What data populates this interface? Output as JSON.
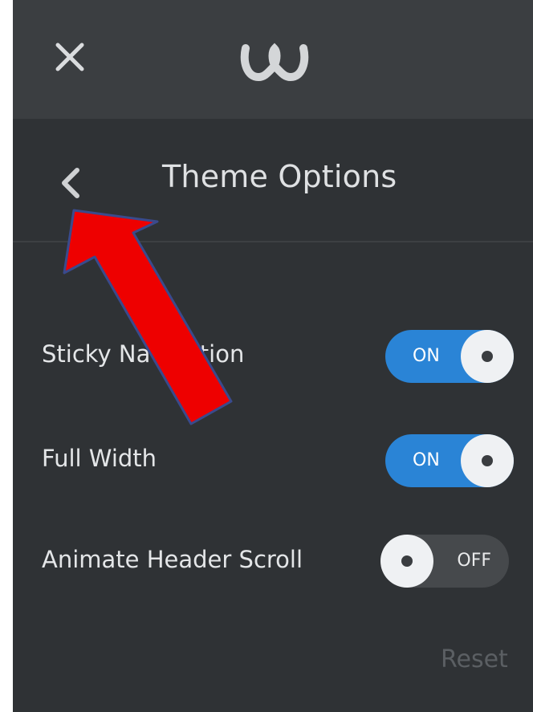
{
  "header": {
    "close_icon": "close-icon",
    "logo_icon": "weebly-logo-icon"
  },
  "panel": {
    "back_icon": "chevron-left-icon",
    "title": "Theme Options"
  },
  "options": [
    {
      "label": "Sticky Navigation",
      "state": "ON",
      "on": true
    },
    {
      "label": "Full Width",
      "state": "ON",
      "on": true
    },
    {
      "label": "Animate Header Scroll",
      "state": "OFF",
      "on": false
    }
  ],
  "footer": {
    "reset_label": "Reset"
  },
  "colors": {
    "panel_bg": "#2f3235",
    "topbar_bg": "#3b3e41",
    "toggle_on": "#2a84d6",
    "toggle_off": "#46494c",
    "annotation_arrow": "#ee0000"
  }
}
